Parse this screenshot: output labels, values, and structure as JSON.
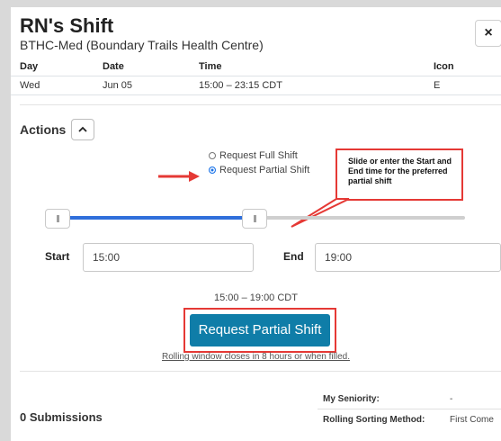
{
  "shift": {
    "title": "RN's Shift",
    "location": "BTHC-Med (Boundary Trails Health Centre)"
  },
  "close_label": "×",
  "table": {
    "headers": [
      "Day",
      "Date",
      "Time",
      "Icon"
    ],
    "rows": [
      [
        "Wed",
        "Jun 05",
        "15:00 – 23:15 CDT",
        "E"
      ]
    ]
  },
  "actions": {
    "label": "Actions",
    "toggle_icon": "chevron-up-icon",
    "options": [
      {
        "label": "Request Full Shift",
        "selected": false
      },
      {
        "label": "Request Partial Shift",
        "selected": true
      }
    ],
    "callout": "Slide or enter the Start and End time for the preferred partial shift",
    "slider": {
      "start_fraction": 0.0,
      "end_fraction": 0.5
    },
    "start_label": "Start",
    "start_value": "15:00",
    "end_label": "End",
    "end_value": "19:00",
    "range_text": "15:00 – 19:00 CDT",
    "submit_label": "Request Partial Shift",
    "rolling_note": "Rolling window closes in 8 hours or when filled."
  },
  "submissions": {
    "label": "0 Submissions",
    "seniority_label": "My Seniority:",
    "seniority_value": "-",
    "sorting_label": "Rolling Sorting Method:",
    "sorting_value": "First Come"
  },
  "colors": {
    "accent": "#0f7da8",
    "slider": "#2f6fdb",
    "annotation": "#e53935"
  }
}
